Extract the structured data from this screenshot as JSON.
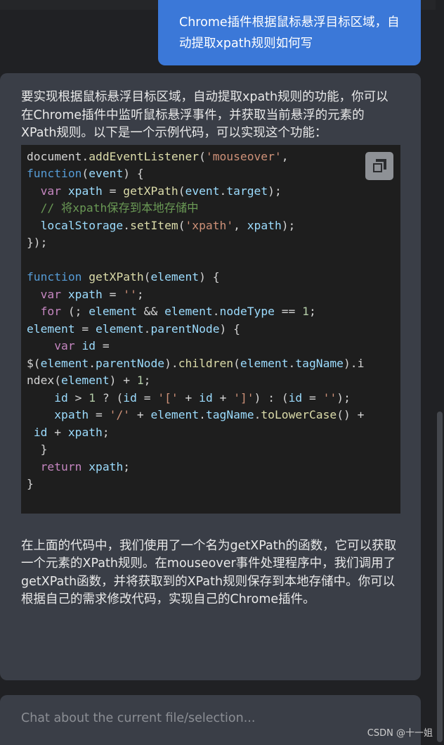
{
  "user_message": "Chrome插件根据鼠标悬浮目标区域，自动提取xpath规则如何写",
  "assistant": {
    "intro": "要实现根据鼠标悬浮目标区域，自动提取xpath规则的功能，你可以在Chrome插件中监听鼠标悬浮事件，并获取当前悬浮的元素的XPath规则。以下是一个示例代码，可以实现这个功能：",
    "code_lines": [
      "document.addEventListener('mouseover',",
      "function(event) {",
      "  var xpath = getXPath(event.target);",
      "  // 将xpath保存到本地存储中",
      "  localStorage.setItem('xpath', xpath);",
      "});",
      "",
      "function getXPath(element) {",
      "  var xpath = '';",
      "  for (; element && element.nodeType == 1;",
      "element = element.parentNode) {",
      "    var id =",
      "$(element.parentNode).children(element.tagName).i",
      "ndex(element) + 1;",
      "    id > 1 ? (id = '[' + id + ']') : (id = '');",
      "    xpath = '/' + element.tagName.toLowerCase() +",
      " id + xpath;",
      "  }",
      "  return xpath;",
      "}"
    ],
    "outro": "在上面的代码中，我们使用了一个名为getXPath的函数，它可以获取一个元素的XPath规则。在mouseover事件处理程序中，我们调用了getXPath函数，并将获取到的XPath规则保存到本地存储中。你可以根据自己的需求修改代码，实现自己的Chrome插件。"
  },
  "input": {
    "placeholder": "Chat about the current file/selection..."
  },
  "watermark": "CSDN @十一姐",
  "colors": {
    "user_bubble": "#3b78d8",
    "assistant_card": "#3a3e47",
    "background": "#202124",
    "code_background": "#1e1e1e"
  },
  "icons": [
    "copy-icon"
  ]
}
